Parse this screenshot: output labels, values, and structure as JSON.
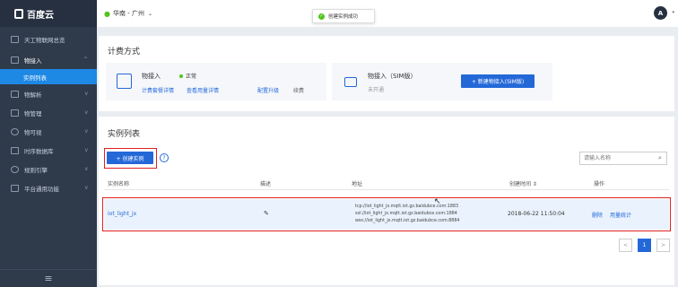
{
  "app": {
    "logo_text": "百度云"
  },
  "sidebar": {
    "items": [
      {
        "label": "天工物联网总览",
        "icon": "grid-icon"
      },
      {
        "label": "物接入",
        "icon": "plug-icon",
        "chevron": "^"
      },
      {
        "label": "实例列表",
        "active": true
      },
      {
        "label": "物解析",
        "icon": "parse-icon",
        "chevron": "v"
      },
      {
        "label": "物管理",
        "icon": "manage-icon",
        "chevron": "v"
      },
      {
        "label": "物可视",
        "icon": "eye-icon",
        "chevron": "v"
      },
      {
        "label": "时序数据库",
        "icon": "database-icon",
        "chevron": "v"
      },
      {
        "label": "规则引擎",
        "icon": "rule-icon",
        "chevron": "v"
      },
      {
        "label": "平台通用功能",
        "icon": "mail-icon",
        "chevron": "v"
      }
    ],
    "collapse_glyph": "≡"
  },
  "topbar": {
    "region": "华南 - 广州",
    "toast": "创建实例成功",
    "avatar": "A"
  },
  "billing": {
    "title": "计费方式",
    "iot_access": {
      "name": "物接入",
      "status": "正常",
      "links": [
        "计费套餐详情",
        "查看用量详情",
        "配置升级",
        "续费"
      ]
    },
    "sim": {
      "name": "物接入（SIM版）",
      "status": "未开通",
      "button": "+ 新建物接入(SIM版)"
    }
  },
  "instances": {
    "title": "实例列表",
    "create_button": "+ 创建实例",
    "search_placeholder": "请输入名称",
    "headers": [
      "实例名称",
      "描述",
      "地址",
      "创建时间 ⇕",
      "操作"
    ],
    "rows": [
      {
        "name": "iot_light_jx",
        "addresses": [
          "tcp://iot_light_jx.mqtt.iot.gz.baidubce.com:1883",
          "ssl://iot_light_jx.mqtt.iot.gz.baidubce.com:1884",
          "wss://iot_light_jx.mqtt.iot.gz.baidubce.com:8884"
        ],
        "created": "2018-06-22 11:50:04",
        "actions": [
          "删除",
          "用量统计"
        ]
      }
    ],
    "pagination": {
      "prev": "<",
      "current": "1",
      "next": ">"
    }
  },
  "colors": {
    "accent": "#2468d8",
    "sidebar": "#2f3a4b",
    "highlight": "#e02020",
    "success": "#52c41a"
  }
}
